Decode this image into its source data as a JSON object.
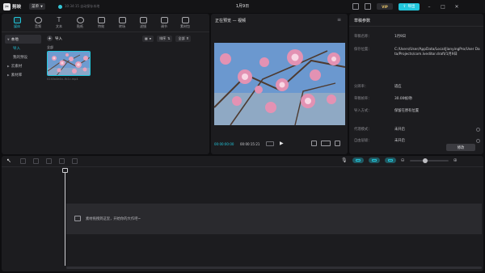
{
  "app": {
    "logo_text": "剪映",
    "menu_label": "菜单",
    "autosave_text": "10:34:15 自动保存本地",
    "project_title": "1月9日",
    "vip_label": "VIP",
    "export_label": "导出"
  },
  "media_toolbar": [
    {
      "label": "媒体",
      "icon": "media-icon",
      "active": true
    },
    {
      "label": "音频",
      "icon": "audio-icon"
    },
    {
      "label": "文本",
      "icon": "text-icon"
    },
    {
      "label": "贴纸",
      "icon": "sticker-icon"
    },
    {
      "label": "特效",
      "icon": "effects-icon"
    },
    {
      "label": "转场",
      "icon": "transition-icon"
    },
    {
      "label": "滤镜",
      "icon": "filter-icon"
    },
    {
      "label": "调节",
      "icon": "adjust-icon"
    },
    {
      "label": "素材包",
      "icon": "package-icon"
    }
  ],
  "media_nav": {
    "local": "本地",
    "import": "导入",
    "my_presets": "我的预设",
    "cloud": "云素材",
    "library": "素材库"
  },
  "media_content": {
    "import_label": "导入",
    "sort_label": "排序",
    "all_filter_label": "全部",
    "all_section": "全部",
    "thumb_name": "0240a4e4a..fb1c.mp4"
  },
  "player": {
    "title": "正在预览 — 视频",
    "time_current": "00:00:00:00",
    "time_total": "00:00:15:21"
  },
  "properties": {
    "title": "草稿参数",
    "rows": [
      {
        "key": "草稿名称：",
        "value": "1月9日"
      },
      {
        "key": "保存位置：",
        "value": "C:/Users/User/AppData/Local/JianyingPro/User Data/Projects/com.lveditor.draft/1月9日"
      },
      {
        "key": "分辨率：",
        "value": "适应"
      },
      {
        "key": "草稿帧率：",
        "value": "30.00帧/秒"
      },
      {
        "key": "导入方式：",
        "value": "保留在原有位置"
      },
      {
        "key": "代理模式：",
        "value": "未开启"
      },
      {
        "key": "自由层级：",
        "value": "未开启"
      }
    ],
    "modify_label": "修改"
  },
  "timeline": {
    "drop_hint": "素材拖拽到这里，开始你的大作吧~"
  },
  "colors": {
    "accent": "#22c7dc",
    "panel_bg": "#1c1c1f",
    "app_bg": "#0e0e10"
  }
}
